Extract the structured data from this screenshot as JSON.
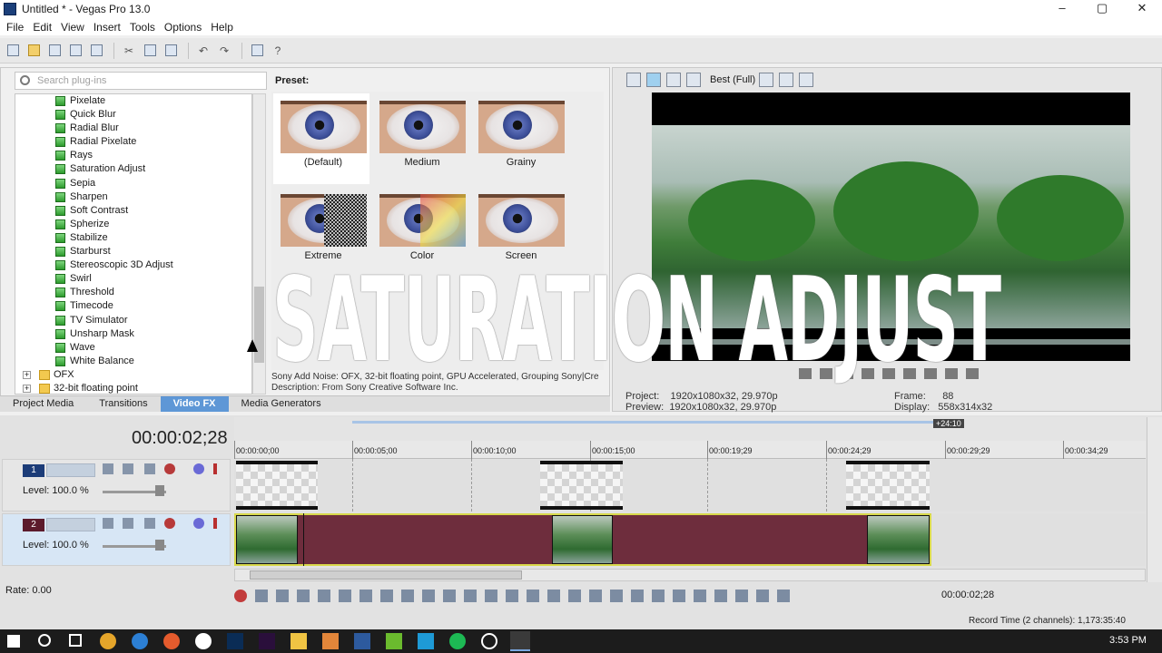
{
  "window": {
    "title": "Untitled * - Vegas Pro 13.0",
    "buttons": [
      "–",
      "▢",
      "✕"
    ]
  },
  "menu": [
    "File",
    "Edit",
    "View",
    "Insert",
    "Tools",
    "Options",
    "Help"
  ],
  "search": {
    "placeholder": "Search plug-ins"
  },
  "tree": {
    "items": [
      "Pixelate",
      "Quick Blur",
      "Radial Blur",
      "Radial Pixelate",
      "Rays",
      "Saturation Adjust",
      "Sepia",
      "Sharpen",
      "Soft Contrast",
      "Spherize",
      "Stabilize",
      "Starburst",
      "Stereoscopic 3D Adjust",
      "Swirl",
      "Threshold",
      "Timecode",
      "TV Simulator",
      "Unsharp Mask",
      "Wave",
      "White Balance"
    ],
    "folders": [
      {
        "exp": "+",
        "label": "OFX"
      },
      {
        "exp": "+",
        "label": "32-bit floating point"
      }
    ]
  },
  "preset": {
    "label": "Preset:",
    "items": [
      "(Default)",
      "Medium",
      "Grainy",
      "Extreme",
      "Color",
      "Screen"
    ],
    "description_line1": "Sony Add Noise: OFX, 32-bit floating point, GPU Accelerated, Grouping Sony|Cre",
    "description_line2": "Description: From Sony Creative Software Inc."
  },
  "tabs": [
    "Project Media",
    "Transitions",
    "Video FX",
    "Media Generators"
  ],
  "active_tab": "Video FX",
  "preview": {
    "quality": "Best (Full)",
    "project_label": "Project:",
    "project_value": "1920x1080x32, 29.970p",
    "preview_label": "Preview:",
    "preview_value": "1920x1080x32, 29.970p",
    "frame_label": "Frame:",
    "frame_value": "88",
    "display_label": "Display:",
    "display_value": "558x314x32"
  },
  "overlay_title": "SATURATION ADJUST",
  "timeline": {
    "timecode": "00:00:02;28",
    "ruler": [
      "00:00:00;00",
      "00:00:05;00",
      "00:00:10;00",
      "00:00:15;00",
      "00:00:19;29",
      "00:00:24;29",
      "00:00:29;29",
      "00:00:34;29"
    ],
    "region_marker": "+24:10",
    "tracks": [
      {
        "number": "1",
        "level": "Level: 100.0 %"
      },
      {
        "number": "2",
        "level": "Level: 100.0 %"
      }
    ],
    "rate": "Rate: 0.00",
    "cursor_time": "00:00:02;28",
    "record_time": "Record Time (2 channels): 1,173:35:40"
  },
  "taskbar": {
    "clock": "3:53 PM"
  },
  "colors": {
    "accent": "#5e97d6",
    "video_track": "#6e2d3d",
    "track_number": "#1c3c78"
  }
}
